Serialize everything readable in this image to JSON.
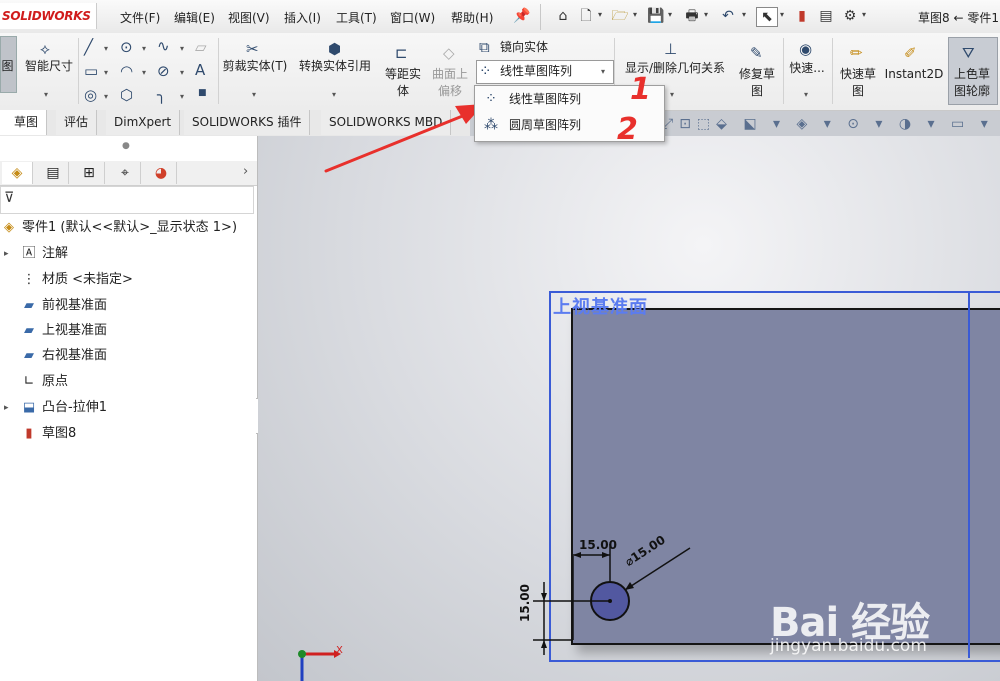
{
  "app": {
    "logo": "SOLIDWORKS",
    "doc_title": "草图8 ← 零件1"
  },
  "menu": [
    "文件(F)",
    "编辑(E)",
    "视图(V)",
    "插入(I)",
    "工具(T)",
    "窗口(W)",
    "帮助(H)"
  ],
  "ribbon": {
    "sketch": "图",
    "smart_dim": "智能尺寸",
    "trim": "剪裁实体(T)",
    "convert": "转换实体引用",
    "offset_1": "等距实",
    "offset_2": "体",
    "surface_offset_1": "曲面上",
    "surface_offset_2": "偏移",
    "mirror": "镜向实体",
    "pattern_select": "线性草图阵列",
    "relations": "显示/删除几何关系",
    "repair_1": "修复草",
    "repair_2": "图",
    "quick_snap": "快速...",
    "rapid_sketch_1": "快速草",
    "rapid_sketch_2": "图",
    "instant2d": "Instant2D",
    "shaded_1": "上色草",
    "shaded_2": "图轮廓"
  },
  "tabs": [
    "草图",
    "评估",
    "DimXpert",
    "SOLIDWORKS 插件",
    "SOLIDWORKS MBD"
  ],
  "flyout": {
    "items": [
      "线性草图阵列",
      "圆周草图阵列"
    ],
    "note_1": "1",
    "note_2": "2"
  },
  "tree": {
    "root": "零件1  (默认<<默认>_显示状态 1>)",
    "items": [
      "注解",
      "材质 <未指定>",
      "前视基准面",
      "上视基准面",
      "右视基准面",
      "原点",
      "凸台-拉伸1",
      "草图8"
    ]
  },
  "graphics": {
    "plane_label": "上视基准面",
    "dim_horizontal": "15.00",
    "dim_diameter": "⌀15.00",
    "dim_vertical": "15.00",
    "axis_x": "X"
  },
  "watermark": {
    "brand": "Bai  经验",
    "url": "jingyan.baidu.com"
  },
  "colors": {
    "plane_fill": "#7f85a3",
    "plane_border": "#3a5bd6",
    "annotation_red": "#e8302c",
    "logo_red": "#d01c1c"
  }
}
